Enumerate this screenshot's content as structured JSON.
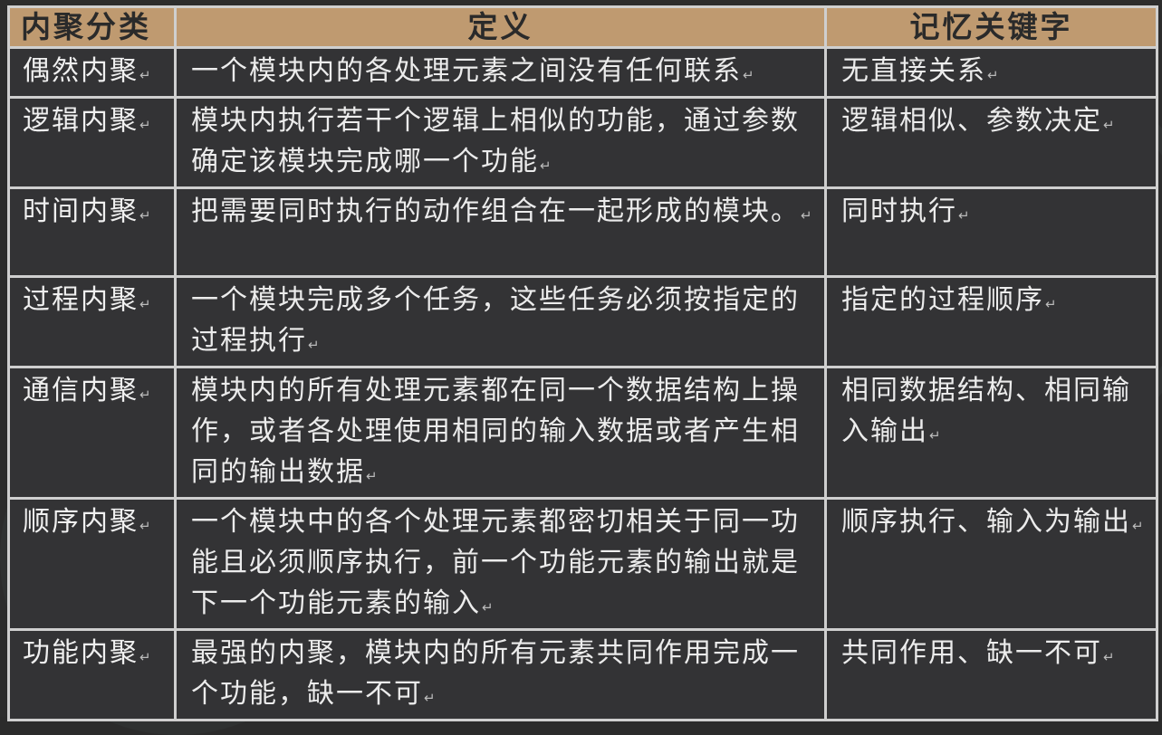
{
  "table": {
    "headers": {
      "category": "内聚分类",
      "definition": "定义",
      "keywords": "记忆关键字"
    },
    "rows": [
      {
        "category": "偶然内聚",
        "definition": "一个模块内的各处理元素之间没有任何联系",
        "keywords": "无直接关系"
      },
      {
        "category": "逻辑内聚",
        "definition": "模块内执行若干个逻辑上相似的功能，通过参数确定该模块完成哪一个功能",
        "keywords": "逻辑相似、参数决定"
      },
      {
        "category": "时间内聚",
        "definition": "把需要同时执行的动作组合在一起形成的模块。",
        "keywords": "同时执行"
      },
      {
        "category": "过程内聚",
        "definition": "一个模块完成多个任务，这些任务必须按指定的过程执行",
        "keywords": "指定的过程顺序"
      },
      {
        "category": "通信内聚",
        "definition": "模块内的所有处理元素都在同一个数据结构上操作，或者各处理使用相同的输入数据或者产生相同的输出数据",
        "keywords": "相同数据结构、相同输入输出"
      },
      {
        "category": "顺序内聚",
        "definition": "一个模块中的各个处理元素都密切相关于同一功能且必须顺序执行，前一个功能元素的输出就是下一个功能元素的输入",
        "keywords": "顺序执行、输入为输出"
      },
      {
        "category": "功能内聚",
        "definition": "最强的内聚，模块内的所有元素共同作用完成一个功能，缺一不可",
        "keywords": "共同作用、缺一不可"
      }
    ]
  },
  "paragraph_mark": "↵"
}
